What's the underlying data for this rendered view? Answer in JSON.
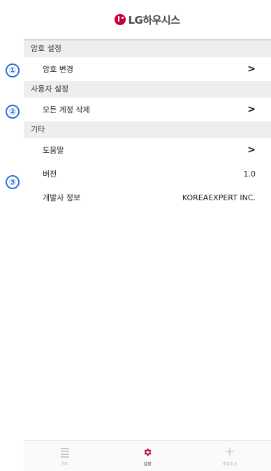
{
  "header": {
    "logo_text": "LG하우시스"
  },
  "sections": [
    {
      "title": "암호 설정"
    },
    {
      "title": "사용자 설정"
    },
    {
      "title": "기타"
    }
  ],
  "rows": {
    "change_password": "암호 변경",
    "delete_accounts": "모든 계정 삭제",
    "help": "도움말",
    "version_label": "버전",
    "version_value": "1.0",
    "developer_label": "개발사 정보",
    "developer_value": "KOREAEXPERT INC."
  },
  "annotations": [
    "①",
    "②",
    "③"
  ],
  "tabbar": {
    "tabs": [
      {
        "label": "list",
        "icon": "list-icon",
        "active": false
      },
      {
        "label": "설정",
        "icon": "gear-icon",
        "active": true
      },
      {
        "label": "계정추가",
        "icon": "plus-icon",
        "active": false
      }
    ]
  },
  "colors": {
    "brand": "#c6003a",
    "annotation": "#2f6fd6",
    "section_bg": "#eeeeee"
  }
}
